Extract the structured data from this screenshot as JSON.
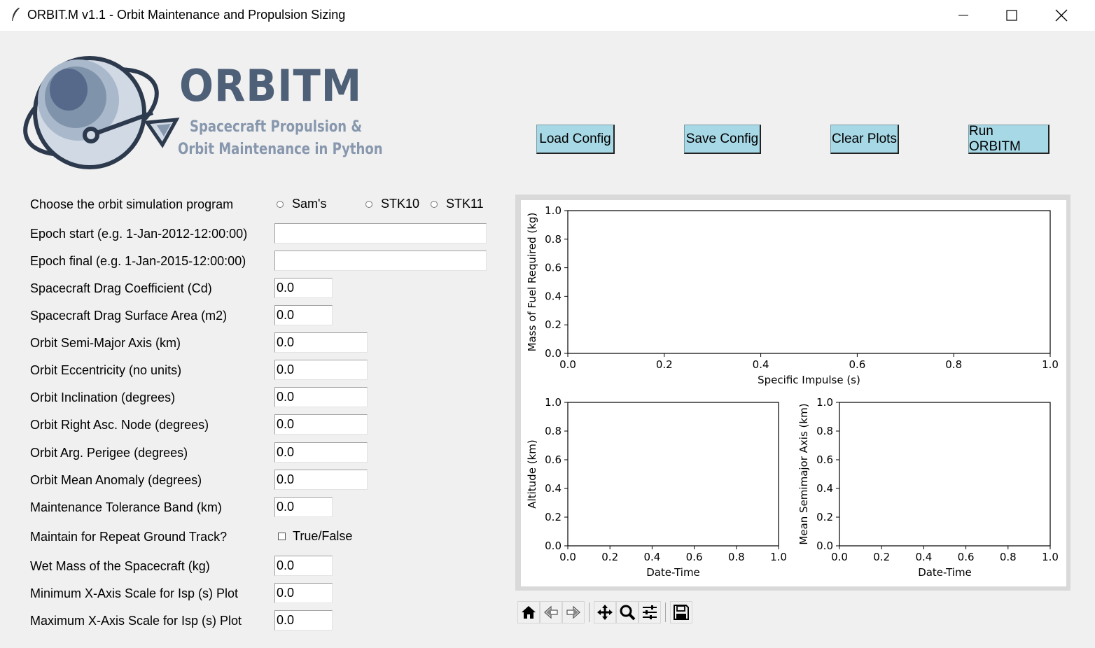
{
  "window": {
    "title": "ORBIT.M v1.1 - Orbit Maintenance and Propulsion Sizing"
  },
  "logo": {
    "title": "ORBITM",
    "subtitle_line1": "Spacecraft Propulsion &",
    "subtitle_line2": "Orbit Maintenance in Python"
  },
  "buttons": {
    "load": "Load Config",
    "save": "Save Config",
    "clear": "Clear Plots",
    "run": "Run ORBITM"
  },
  "program_select": {
    "label": "Choose the orbit simulation program",
    "options": [
      "Sam's",
      "STK10",
      "STK11"
    ],
    "selected": ""
  },
  "fields": {
    "epoch_start": {
      "label": "Epoch start (e.g. 1-Jan-2012-12:00:00)",
      "value": ""
    },
    "epoch_final": {
      "label": "Epoch final (e.g. 1-Jan-2015-12:00:00)",
      "value": ""
    },
    "drag_coeff": {
      "label": "Spacecraft Drag Coefficient (Cd)",
      "value": "0.0"
    },
    "drag_area": {
      "label": "Spacecraft Drag Surface Area (m2)",
      "value": "0.0"
    },
    "sma": {
      "label": "Orbit Semi-Major Axis (km)",
      "value": "0.0"
    },
    "ecc": {
      "label": "Orbit Eccentricity (no units)",
      "value": "0.0"
    },
    "inc": {
      "label": "Orbit Inclination (degrees)",
      "value": "0.0"
    },
    "raan": {
      "label": "Orbit Right Asc. Node (degrees)",
      "value": "0.0"
    },
    "argp": {
      "label": "Orbit Arg. Perigee (degrees)",
      "value": "0.0"
    },
    "mean_anom": {
      "label": "Orbit Mean Anomaly (degrees)",
      "value": "0.0"
    },
    "tolerance": {
      "label": "Maintenance Tolerance Band (km)",
      "value": "0.0"
    },
    "wet_mass": {
      "label": "Wet Mass of the Spacecraft (kg)",
      "value": "0.0"
    },
    "isp_min": {
      "label": "Minimum X-Axis Scale for Isp (s) Plot",
      "value": "0.0"
    },
    "isp_max": {
      "label": "Maximum X-Axis Scale for Isp (s) Plot",
      "value": "0.0"
    }
  },
  "repeat_track": {
    "label": "Maintain for Repeat Ground Track?",
    "checkbox_label": "True/False",
    "checked": false
  },
  "chart_data": [
    {
      "type": "line",
      "title": "",
      "xlabel": "Specific Impulse (s)",
      "ylabel": "Mass of Fuel Required (kg)",
      "xlim": [
        0.0,
        1.0
      ],
      "ylim": [
        0.0,
        1.0
      ],
      "xticks": [
        "0.0",
        "0.2",
        "0.4",
        "0.6",
        "0.8",
        "1.0"
      ],
      "yticks": [
        "0.0",
        "0.2",
        "0.4",
        "0.6",
        "0.8",
        "1.0"
      ],
      "series": []
    },
    {
      "type": "line",
      "title": "",
      "xlabel": "Date-Time",
      "ylabel": "Altitude (km)",
      "xlim": [
        0.0,
        1.0
      ],
      "ylim": [
        0.0,
        1.0
      ],
      "xticks": [
        "0.0",
        "0.2",
        "0.4",
        "0.6",
        "0.8",
        "1.0"
      ],
      "yticks": [
        "0.0",
        "0.2",
        "0.4",
        "0.6",
        "0.8",
        "1.0"
      ],
      "series": []
    },
    {
      "type": "line",
      "title": "",
      "xlabel": "Date-Time",
      "ylabel": "Mean Semimajor Axis (km)",
      "xlim": [
        0.0,
        1.0
      ],
      "ylim": [
        0.0,
        1.0
      ],
      "xticks": [
        "0.0",
        "0.2",
        "0.4",
        "0.6",
        "0.8",
        "1.0"
      ],
      "yticks": [
        "0.0",
        "0.2",
        "0.4",
        "0.6",
        "0.8",
        "1.0"
      ],
      "series": []
    }
  ],
  "toolbar": {
    "icons": [
      "home-icon",
      "back-icon",
      "forward-icon",
      "pan-icon",
      "zoom-icon",
      "configure-subplots-icon",
      "save-figure-icon"
    ]
  }
}
